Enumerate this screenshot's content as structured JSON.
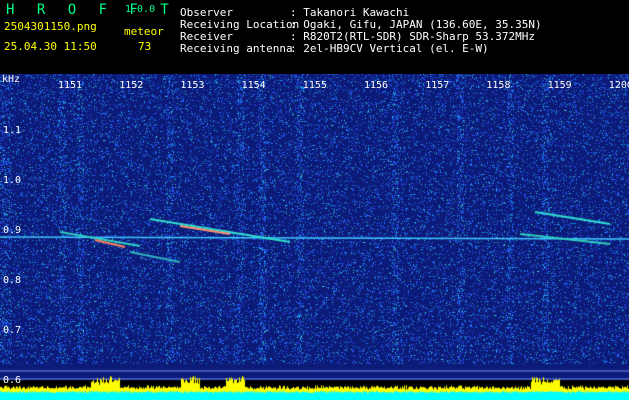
{
  "app": {
    "title": "H R O F F T",
    "version": "1.0.0"
  },
  "file": {
    "name": "2504301150.png",
    "timestamp": "25.04.30 11:50"
  },
  "meteor": {
    "label": "meteor",
    "count": "73"
  },
  "info": [
    {
      "key": "Observer",
      "value": ": Takanori Kawachi"
    },
    {
      "key": "Receiving Location",
      "value": ": Ogaki, Gifu, JAPAN (136.60E, 35.35N)"
    },
    {
      "key": "Receiver",
      "value": ": R820T2(RTL-SDR) SDR-Sharp 53.372MHz"
    },
    {
      "key": "Receiving antenna",
      "value": ": 2el-HB9CV Vertical (el. E-W)"
    }
  ],
  "spectrogram": {
    "y_unit": "kHz",
    "y_ticks": [
      "1.1",
      "1.0",
      "0.9",
      "0.8",
      "0.7",
      "0.6"
    ],
    "x_ticks": [
      "1151",
      "1152",
      "1153",
      "1154",
      "1155",
      "1156",
      "1157",
      "1158",
      "1159",
      "1200"
    ],
    "colors": {
      "background": "#0c1a78",
      "noise": "#3c78ff",
      "signal": "#00e0e0",
      "power_base": "#00ffff",
      "power_peak": "#ffff00"
    }
  }
}
